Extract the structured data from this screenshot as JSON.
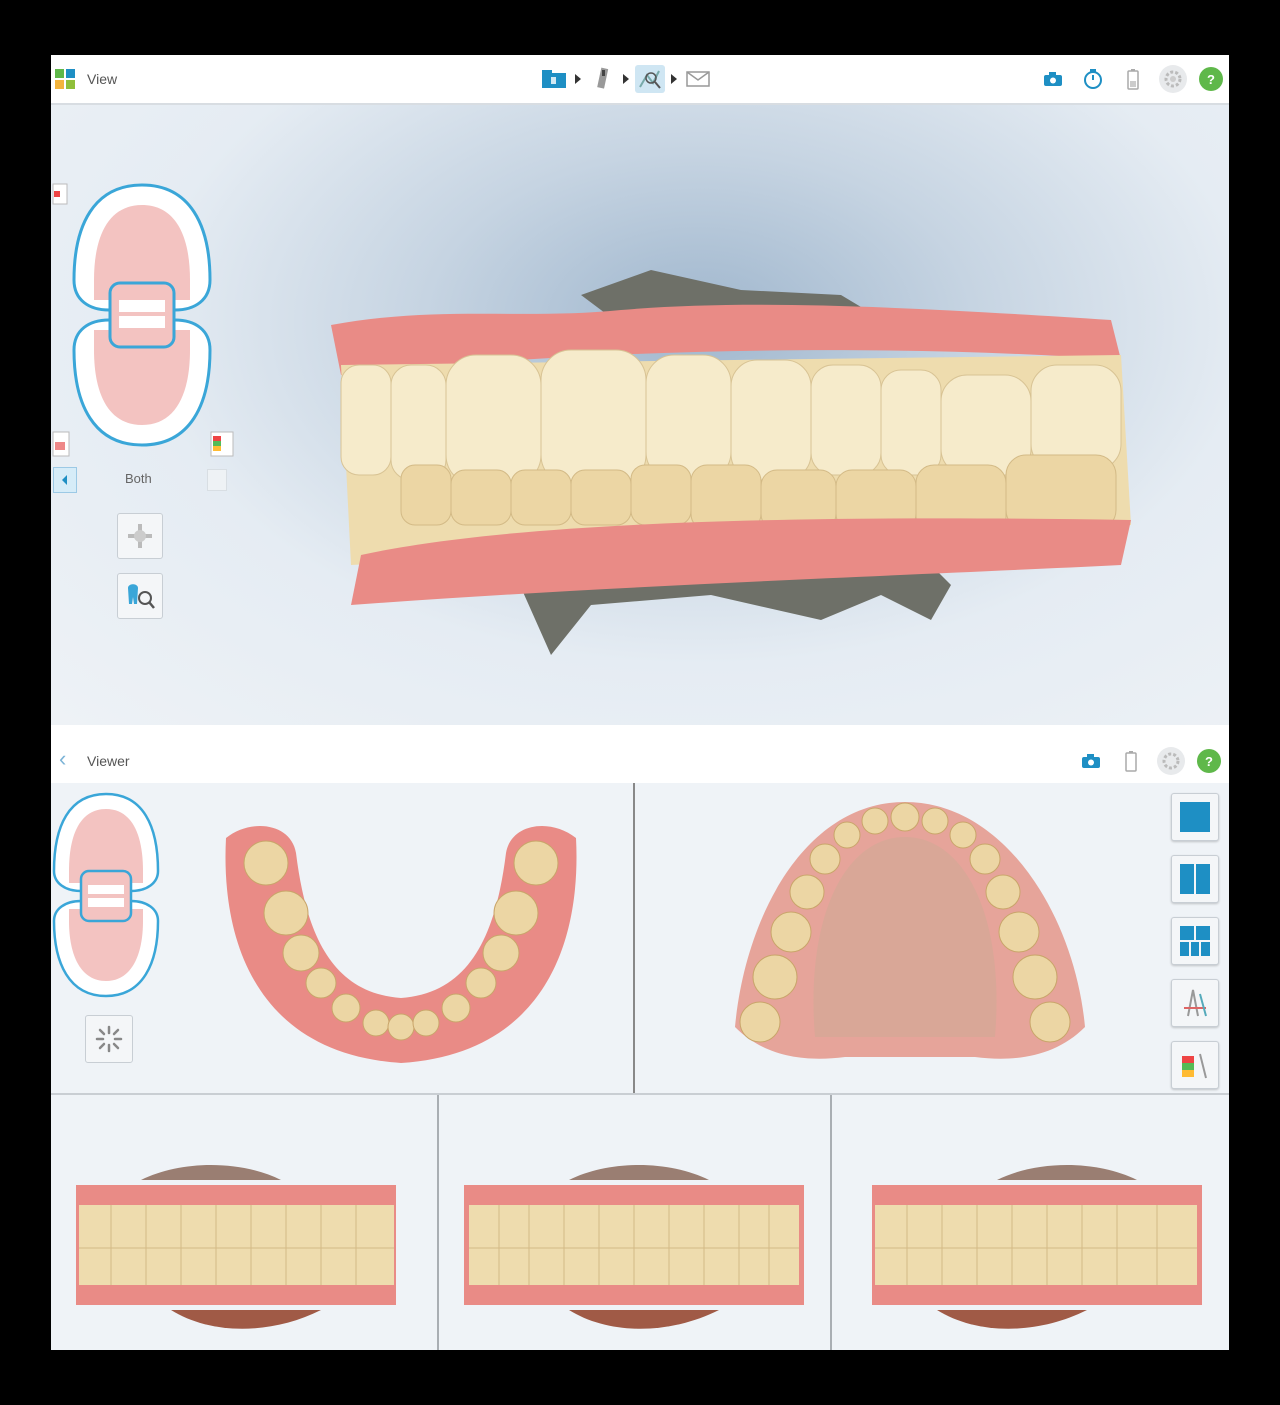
{
  "app": {
    "title": "View",
    "workflow_steps": [
      "folder-icon",
      "scanner-icon",
      "view-tool-icon",
      "send-icon"
    ],
    "active_step": 2,
    "top_icons": [
      "camera-icon",
      "timer-icon",
      "battery-icon",
      "settings-icon",
      "help-icon"
    ]
  },
  "left_panel": {
    "arch_selector": "Both",
    "tools": [
      "rotate-tool-icon",
      "tooth-magnify-icon"
    ]
  },
  "viewer": {
    "title": "Viewer",
    "top_icons": [
      "camera-icon",
      "battery-icon",
      "settings-icon",
      "help-icon"
    ],
    "layout_buttons": [
      "single-view-icon",
      "dual-view-icon",
      "multi-view-icon",
      "bite-analysis-icon",
      "color-analysis-icon"
    ],
    "panes": [
      "lower-arch-occlusal",
      "upper-arch-occlusal",
      "bite-right",
      "bite-front",
      "bite-left"
    ]
  },
  "colors": {
    "accent": "#1e8fc4",
    "gum": "#e98b86",
    "tooth": "#eedcae",
    "model_base": "#6e7068",
    "help_green": "#5fb84a"
  }
}
